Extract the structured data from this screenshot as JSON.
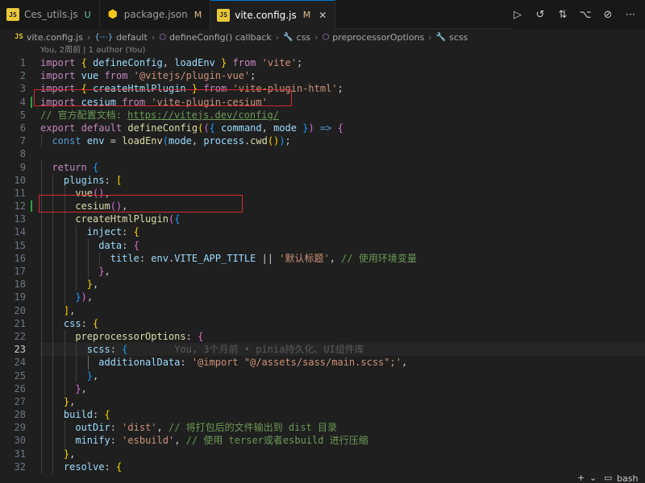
{
  "tabs": [
    {
      "label": "Ces_utils.js",
      "status": "U",
      "icon": "js-file-icon",
      "active": false
    },
    {
      "label": "package.json",
      "status": "M",
      "icon": "json-file-icon",
      "active": false
    },
    {
      "label": "vite.config.js",
      "status": "M",
      "icon": "vite-file-icon",
      "active": true
    }
  ],
  "tab_icon_text": {
    "js": "JS",
    "json": "{}",
    "vite": "⚡"
  },
  "close_glyph": "✕",
  "actions": [
    "run-icon",
    "timeline-icon",
    "compare-icon",
    "git-icon",
    "back-icon",
    "more-icon"
  ],
  "action_glyphs": [
    "▷",
    "↺",
    "⇅",
    "⌥",
    "⊘",
    "⋯"
  ],
  "breadcrumb": [
    "vite.config.js",
    "default",
    "defineConfig() callback",
    "css",
    "preprocessorOptions",
    "scss"
  ],
  "breadcrumb_icons": [
    "JS",
    "{⋯}",
    "⬡",
    "🔧",
    "⬡",
    "🔧"
  ],
  "blame_header": "You, 2周前 | 1 author (You)",
  "inline_blame": "You, 3个月前 • pinia持久化、UI组件库",
  "current_line": 23,
  "code_lines": [
    "import { defineConfig, loadEnv } from 'vite';",
    "import vue from '@vitejs/plugin-vue';",
    "import { createHtmlPlugin } from 'vite-plugin-html';",
    "import cesium from 'vite-plugin-cesium'",
    "// 官方配置文档: https://vitejs.dev/config/",
    "export default defineConfig(({ command, mode }) => {",
    "  const env = loadEnv(mode, process.cwd());",
    "",
    "  return {",
    "    plugins: [",
    "      vue(),",
    "      cesium(),",
    "      createHtmlPlugin({",
    "        inject: {",
    "          data: {",
    "            title: env.VITE_APP_TITLE || '默认标题', // 使用环境变量",
    "          },",
    "        },",
    "      }),",
    "    ],",
    "    css: {",
    "      preprocessorOptions: {",
    "        scss: {",
    "          additionalData: '@import \"@/assets/sass/main.scss\";',",
    "        },",
    "      },",
    "    },",
    "    build: {",
    "      outDir: 'dist', // 将打包后的文件输出到 dist 目录",
    "      minify: 'esbuild', // 使用 terser或者esbuild 进行压缩",
    "    },",
    "    resolve: {"
  ],
  "bottom_right": {
    "plus": "+",
    "chevron": "⌄",
    "bash": "bash"
  },
  "colors": {
    "highlight_box": "#d62b2b",
    "git_added": "#2ea043",
    "accent": "#0078d4"
  }
}
